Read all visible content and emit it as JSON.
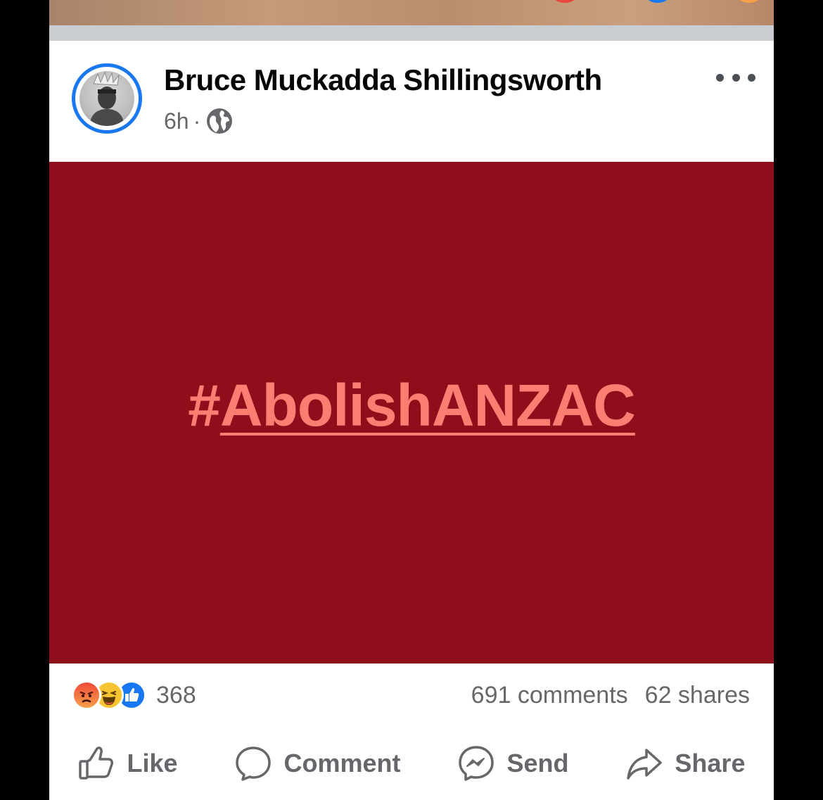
{
  "post": {
    "author": "Bruce Muckadda Shillingsworth",
    "time": "6h",
    "separator": "·",
    "privacy_icon": "globe-icon",
    "body_hash": "#",
    "body_tag": "AbolishANZAC",
    "body_bg_color": "#8e0e1c",
    "body_text_color": "#fa7f72"
  },
  "stats": {
    "reaction_icons": [
      "angry-icon",
      "haha-icon",
      "like-icon"
    ],
    "reaction_count": "368",
    "comments": "691 comments",
    "shares": "62 shares"
  },
  "actions": {
    "like": "Like",
    "comment": "Comment",
    "send": "Send",
    "share": "Share"
  },
  "colors": {
    "accent": "#1877f2",
    "muted_text": "#65676b"
  }
}
